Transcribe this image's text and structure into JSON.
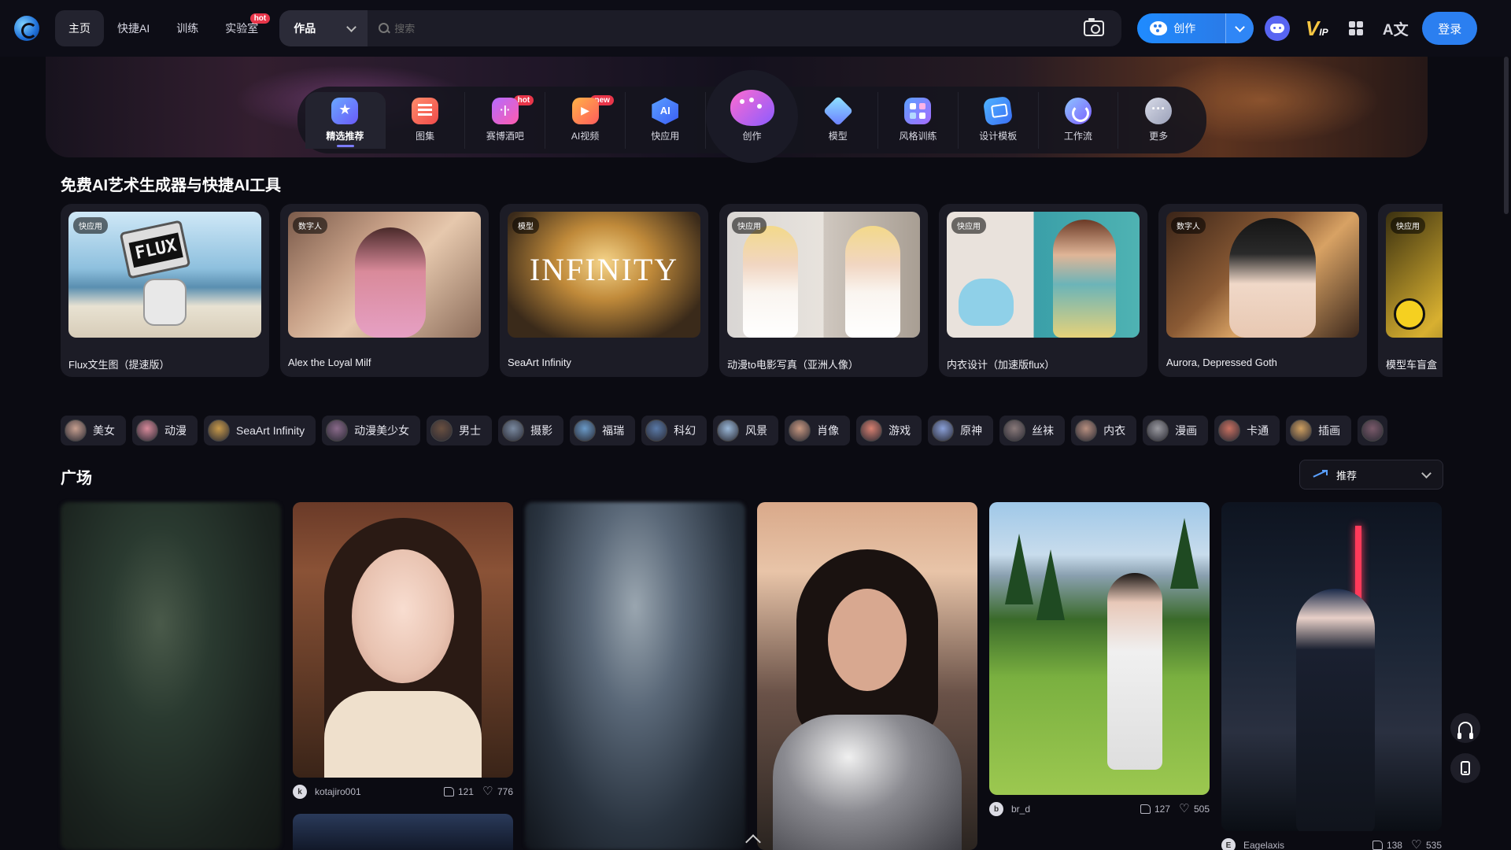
{
  "nav": {
    "items": [
      {
        "label": "主页",
        "active": true
      },
      {
        "label": "快捷AI"
      },
      {
        "label": "训练"
      },
      {
        "label": "实验室",
        "badge": "hot"
      }
    ]
  },
  "search": {
    "scope": "作品",
    "placeholder": "搜索"
  },
  "actions": {
    "create_label": "创作",
    "vip_label": "V",
    "vip_sub": "IP",
    "translate_glyph": "A文",
    "login_label": "登录"
  },
  "dock": {
    "items": [
      {
        "label": "精选推荐",
        "icon": "featured-star-icon"
      },
      {
        "label": "图集",
        "icon": "album-icon"
      },
      {
        "label": "赛博酒吧",
        "icon": "voice-bar-icon",
        "badge": "hot"
      },
      {
        "label": "AI视频",
        "icon": "video-icon",
        "badge": "new"
      },
      {
        "label": "快应用",
        "icon": "ai-app-icon"
      },
      {
        "label": "创作",
        "icon": "palette-icon"
      },
      {
        "label": "模型",
        "icon": "cube-icon"
      },
      {
        "label": "风格训练",
        "icon": "style-train-icon"
      },
      {
        "label": "设计模板",
        "icon": "design-template-icon"
      },
      {
        "label": "工作流",
        "icon": "workflow-icon"
      },
      {
        "label": "更多",
        "icon": "more-icon"
      }
    ]
  },
  "tools": {
    "title": "免费AI艺术生成器与快捷AI工具",
    "cards": [
      {
        "tag": "快应用",
        "title": "Flux文生图（提速版）",
        "thumb_text": "FLUX"
      },
      {
        "tag": "数字人",
        "title": "Alex the Loyal Milf"
      },
      {
        "tag": "模型",
        "title": "SeaArt Infinity",
        "thumb_text": "INFINITY"
      },
      {
        "tag": "快应用",
        "title": "动漫to电影写真（亚洲人像）"
      },
      {
        "tag": "快应用",
        "title": "内衣设计（加速版flux）"
      },
      {
        "tag": "数字人",
        "title": "Aurora, Depressed Goth"
      },
      {
        "tag": "快应用",
        "title": "模型车盲盒"
      }
    ]
  },
  "chips": [
    {
      "label": "美女",
      "color": "#c8a090"
    },
    {
      "label": "动漫",
      "color": "#d88a9a"
    },
    {
      "label": "SeaArt Infinity",
      "color": "#c89a4a"
    },
    {
      "label": "动漫美少女",
      "color": "#8a6a8a"
    },
    {
      "label": "男士",
      "color": "#6a5040"
    },
    {
      "label": "摄影",
      "color": "#7a8aa0"
    },
    {
      "label": "福瑞",
      "color": "#6a9ac8"
    },
    {
      "label": "科幻",
      "color": "#5a7aa8"
    },
    {
      "label": "风景",
      "color": "#9ab8d8"
    },
    {
      "label": "肖像",
      "color": "#c89880"
    },
    {
      "label": "游戏",
      "color": "#d88070"
    },
    {
      "label": "原神",
      "color": "#8aa0d8"
    },
    {
      "label": "丝袜",
      "color": "#8a7a7a"
    },
    {
      "label": "内衣",
      "color": "#b89080"
    },
    {
      "label": "漫画",
      "color": "#9a9aa0"
    },
    {
      "label": "卡通",
      "color": "#c87060"
    },
    {
      "label": "插画",
      "color": "#d0a060"
    },
    {
      "label": "",
      "color": "#7a5a6a"
    }
  ],
  "plaza": {
    "title": "广场",
    "sort_label": "推荐",
    "cards": [
      {
        "author": "kotajiro001",
        "avatar": "k",
        "likes": "121",
        "favorites": "776"
      },
      {
        "author": "br_d",
        "avatar": "b",
        "likes": "127",
        "favorites": "505"
      },
      {
        "author": "Eagelaxis",
        "avatar": "E",
        "likes": "138",
        "favorites": "535"
      }
    ]
  }
}
